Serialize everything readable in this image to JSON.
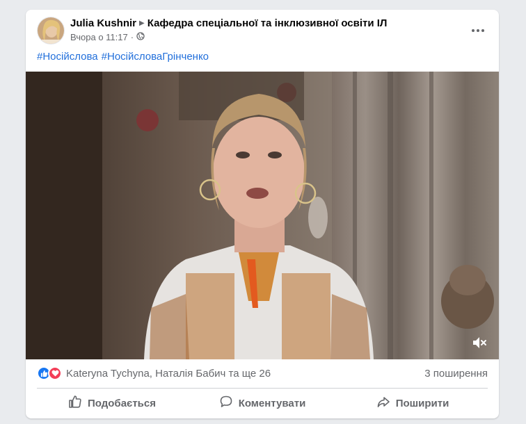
{
  "post": {
    "author": "Julia Kushnir",
    "group": "Кафедра спеціальної та інклюзивної освіти ІЛ",
    "timestamp": "Вчора о 11:17",
    "more_label": "•••",
    "hashtags": [
      "#Носійслова",
      "#НосійсловаГрінченко"
    ]
  },
  "reactions": {
    "names": "Kateryna Tychyna, Наталія Бабич та ще 26",
    "shares": "3 поширення"
  },
  "actions": {
    "like": "Подобається",
    "comment": "Коментувати",
    "share": "Поширити"
  },
  "colors": {
    "link": "#216fdb",
    "like_blue": "#1877f2",
    "love_red": "#f33e58",
    "secondary_text": "#65676b"
  },
  "icons": {
    "audience": "globe-icon",
    "mute": "speaker-muted-icon"
  }
}
